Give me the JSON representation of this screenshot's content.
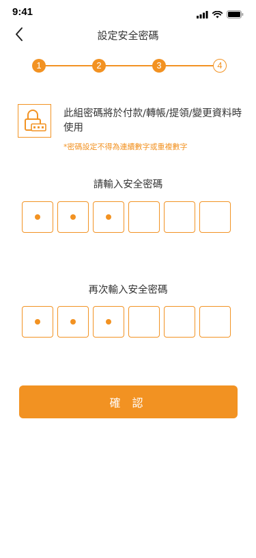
{
  "status_bar": {
    "time": "9:41"
  },
  "nav": {
    "title": "設定安全密碼",
    "back_icon": "chevron-left-icon"
  },
  "stepper": {
    "steps": [
      "1",
      "2",
      "3",
      "4"
    ],
    "current_step": 3,
    "accent_color": "#F29222"
  },
  "info": {
    "icon": "lock-with-keypad-icon",
    "text": "此組密碼將於付款/轉帳/提領/變更資料時使用",
    "note": "*密碼設定不得為連續數字或重複數字"
  },
  "pin_entry": {
    "label": "請輸入安全密碼",
    "length": 6,
    "filled": 3
  },
  "pin_confirm": {
    "label": "再次輸入安全密碼",
    "length": 6,
    "filled": 3
  },
  "confirm_button": {
    "label": "確 認"
  }
}
